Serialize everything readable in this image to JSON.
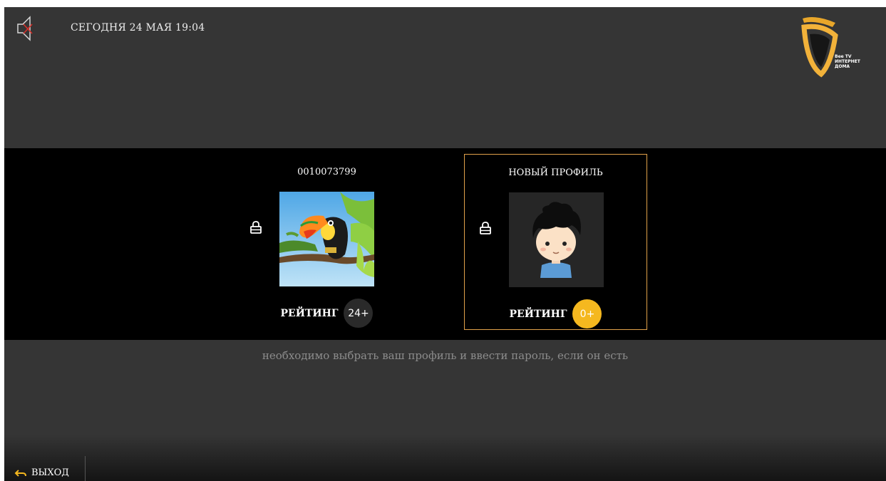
{
  "header": {
    "datetime": "СЕГОДНЯ 24 МАЯ 19:04",
    "logo": {
      "line1": "Bee TV",
      "line2": "ИНТЕРНЕТ",
      "line3": "ДОМА"
    },
    "icons": {
      "mute": "mute-icon"
    }
  },
  "profiles": [
    {
      "name": "0010073799",
      "avatar": "toucan-avatar",
      "locked": true,
      "rating_label": "РЕЙТИНГ",
      "rating": "24+",
      "selected": false
    },
    {
      "name": "НОВЫЙ ПРОФИЛЬ",
      "avatar": "boy-avatar",
      "locked": true,
      "rating_label": "РЕЙТИНГ",
      "rating": "0+",
      "selected": true
    }
  ],
  "hint": "необходимо выбрать ваш профиль и ввести пароль, если он есть",
  "footer": {
    "exit_label": "ВЫХОД"
  },
  "colors": {
    "background": "#353535",
    "band": "#000000",
    "accent": "#f5b81f",
    "selection_border": "#e0a14a",
    "rating_dark": "#2a2a2a"
  }
}
